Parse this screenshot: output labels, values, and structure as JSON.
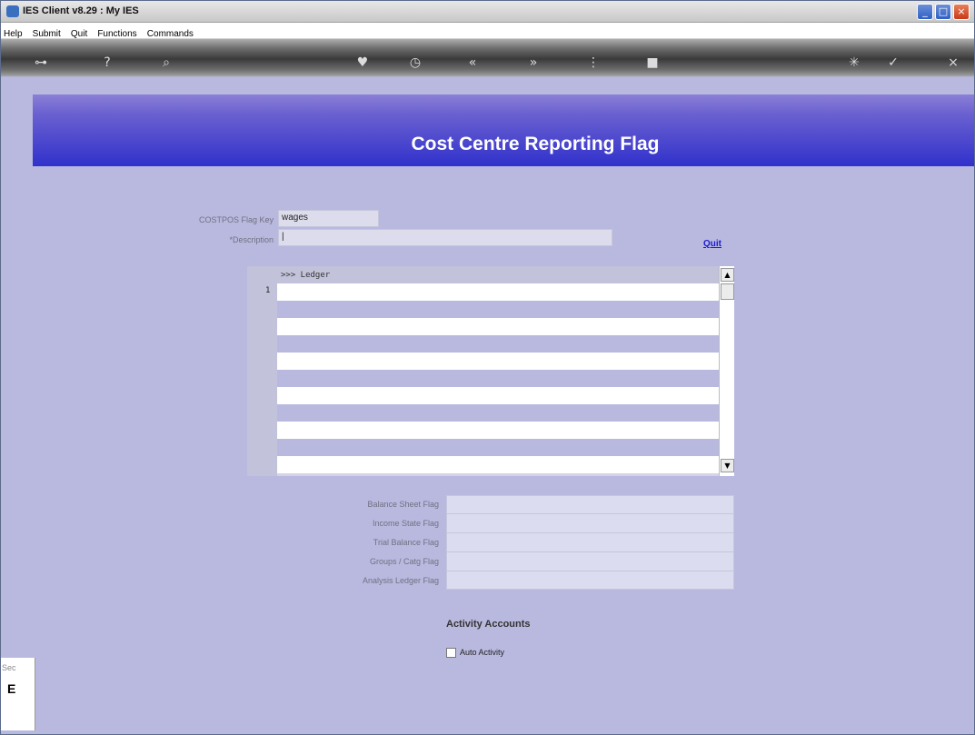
{
  "window": {
    "title": "IES Client v8.29 : My IES",
    "minimize": "_",
    "maximize": "□",
    "close": "×"
  },
  "menu": [
    "Help",
    "Submit",
    "Quit",
    "Functions",
    "Commands"
  ],
  "toolbar_icons": [
    {
      "name": "key-icon",
      "glyph": "⊶"
    },
    {
      "name": "help-icon",
      "glyph": "?"
    },
    {
      "name": "search-icon",
      "glyph": "⌕"
    },
    {
      "name": "heart-icon",
      "glyph": "♥"
    },
    {
      "name": "clock-icon",
      "glyph": "◷"
    },
    {
      "name": "rewind-icon",
      "glyph": "«"
    },
    {
      "name": "forward-icon",
      "glyph": "»"
    },
    {
      "name": "split-icon",
      "glyph": "⋮"
    },
    {
      "name": "stop-icon",
      "glyph": "■"
    },
    {
      "name": "settings-icon",
      "glyph": "✳"
    },
    {
      "name": "ok-icon",
      "glyph": "✓"
    },
    {
      "name": "cancel-icon",
      "glyph": "×"
    }
  ],
  "page": {
    "title": "Cost Centre Reporting Flag"
  },
  "form": {
    "flag_key_label": "COSTPOS Flag Key",
    "flag_key_value": "wages",
    "description_label": "*Description",
    "description_value": "|",
    "quit_link": "Quit"
  },
  "grid": {
    "header": ">>> Ledger",
    "row_number": "1",
    "rows": [
      "",
      "",
      "",
      "",
      "",
      "",
      "",
      "",
      "",
      "",
      ""
    ],
    "scroll_up": "▲",
    "scroll_down": "▼"
  },
  "flags": [
    {
      "label": "Balance Sheet Flag",
      "value": ""
    },
    {
      "label": "Income State Flag",
      "value": ""
    },
    {
      "label": "Trial Balance Flag",
      "value": ""
    },
    {
      "label": "Groups / Catg Flag",
      "value": ""
    },
    {
      "label": "Analysis Ledger Flag",
      "value": ""
    }
  ],
  "activity": {
    "section_title": "Activity Accounts",
    "auto_activity_label": "Auto Activity",
    "auto_activity_checked": false
  },
  "side_panel": {
    "label": "Sec",
    "glyph": "E"
  }
}
